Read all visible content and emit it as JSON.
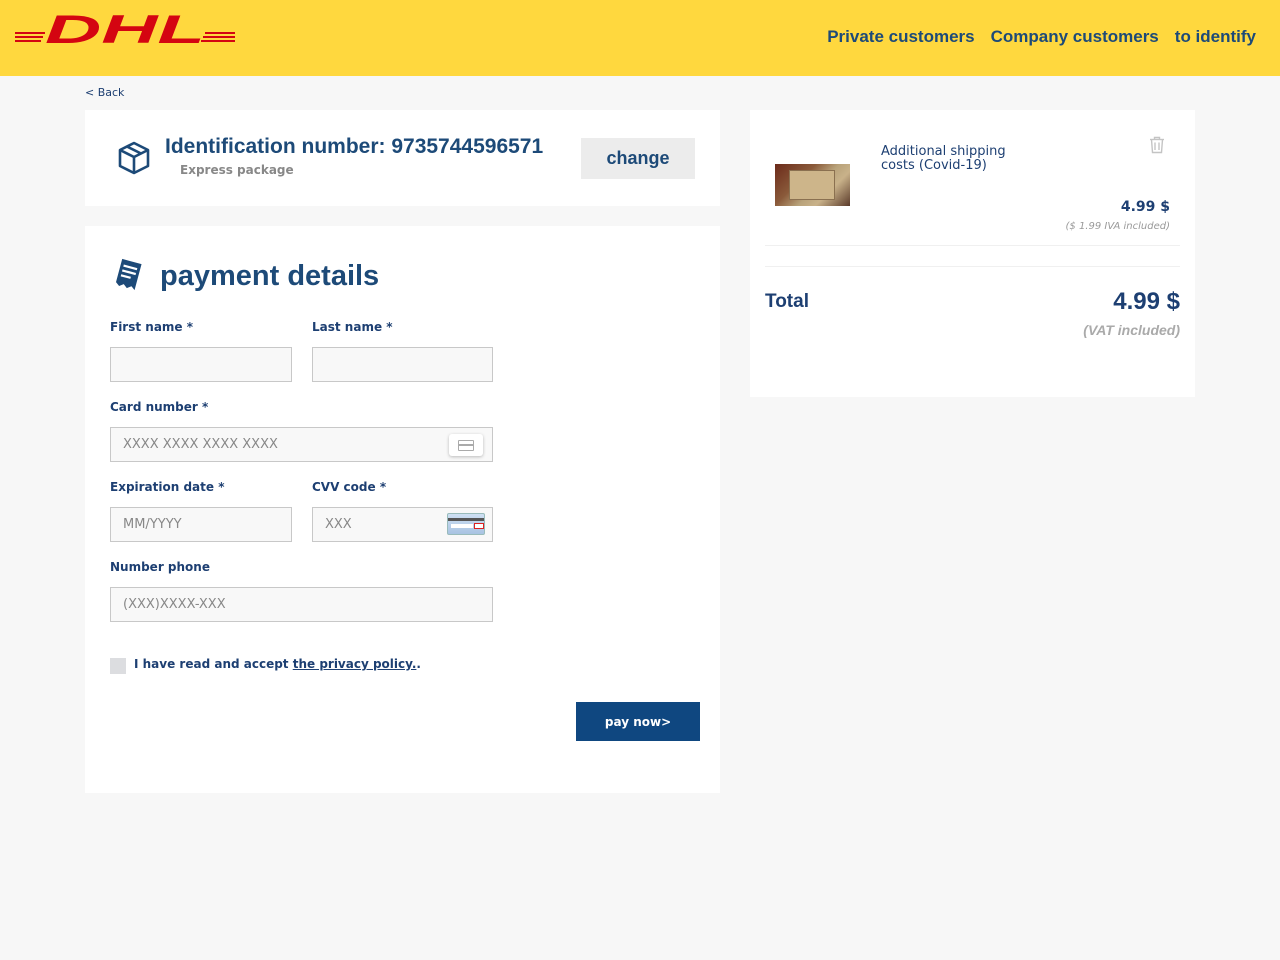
{
  "brand": {
    "logo_text": "DHL",
    "primary_color": "#ffd83e",
    "accent_color": "#d40511",
    "navy": "#0f4780"
  },
  "nav": {
    "items": [
      "Private customers",
      "Company customers",
      "to identify"
    ]
  },
  "back_label": "< Back",
  "shipment": {
    "title": "Identification number: 9735744596571",
    "type": "Express package",
    "change_label": "change"
  },
  "payment": {
    "title": "payment details",
    "first_name_label": "First name *",
    "last_name_label": "Last name *",
    "card_number_label": "Card number *",
    "card_number_placeholder": "XXXX XXXX XXXX XXXX",
    "expiration_label": "Expiration date *",
    "expiration_placeholder": "MM/YYYY",
    "cvv_label": "CVV code *",
    "cvv_placeholder": "XXX",
    "phone_label": "Number phone",
    "phone_placeholder": "(XXX)XXXX-XXX",
    "consent_text": "I have read and accept ",
    "consent_link": "the privacy policy.",
    "consent_suffix": ".",
    "pay_label": "pay now>"
  },
  "summary": {
    "item_name": "Additional shipping costs (Covid-19)",
    "item_price": "4.99 $",
    "item_vat": "($ 1.99 IVA included)",
    "total_label": "Total",
    "total_value": "4.99 $",
    "total_vat": "(VAT included)"
  }
}
